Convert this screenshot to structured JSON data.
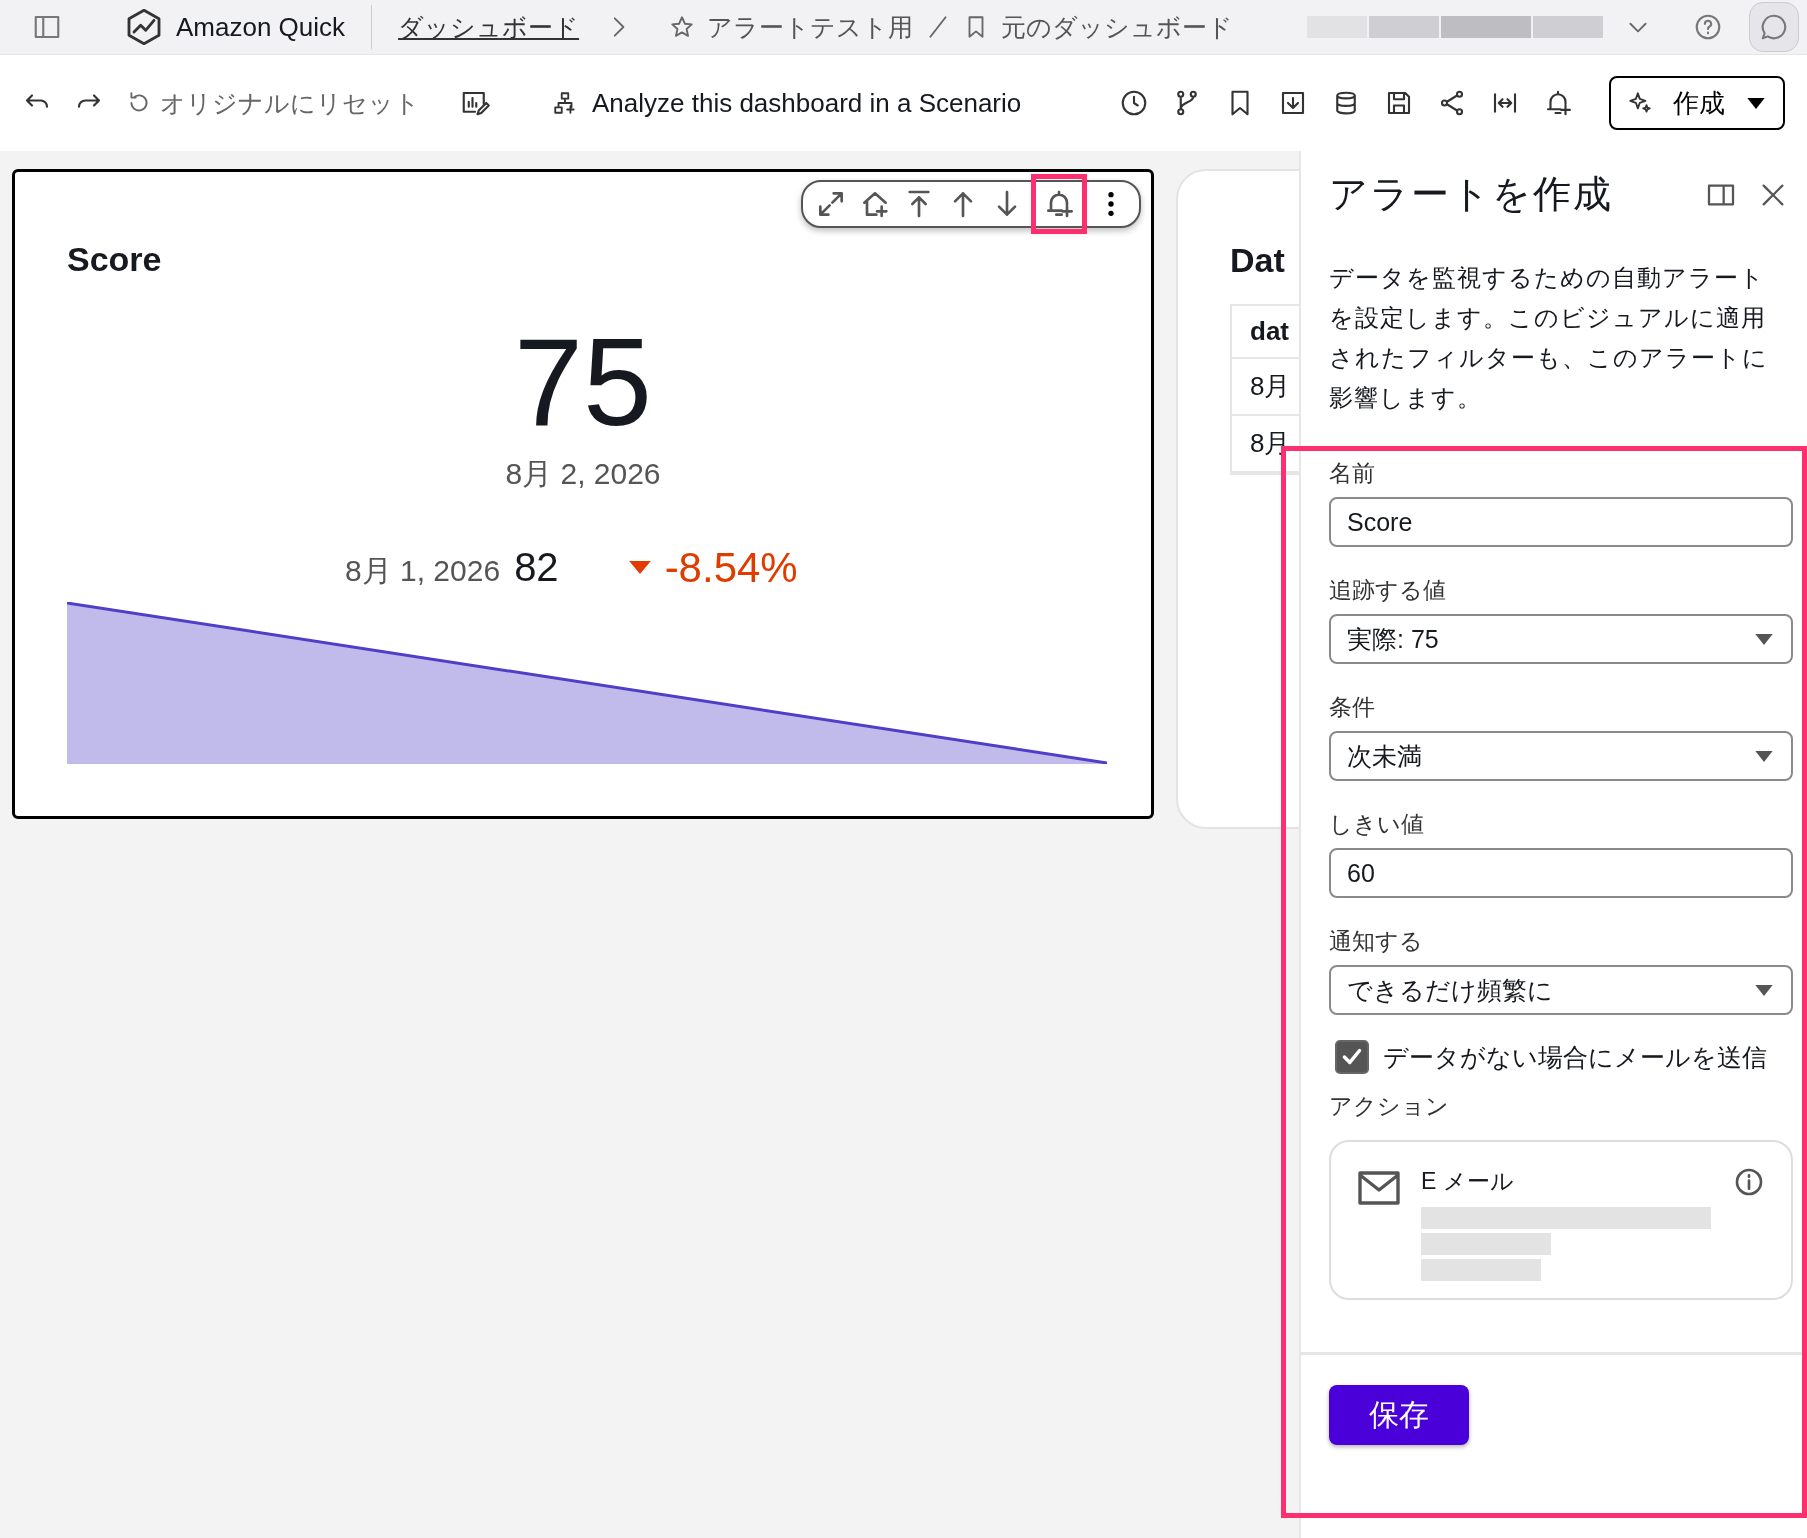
{
  "top_bar": {
    "product": "Amazon Quick",
    "breadcrumbs": [
      {
        "label": "ダッシュボード",
        "kind": "link"
      },
      {
        "label": "アラートテスト用",
        "kind": "star"
      },
      {
        "label": "元のダッシュボード",
        "kind": "bookmark"
      }
    ]
  },
  "toolbar": {
    "reset": {
      "label": "オリジナルにリセット",
      "disabled": true
    },
    "scenario": "Analyze this dashboard in a Scenario",
    "create": "作成"
  },
  "kpi": {
    "title": "Score",
    "value": "75",
    "date": "8月 2, 2026",
    "compare_date": "8月 1, 2026",
    "compare_value": "82",
    "change": "-8.54%"
  },
  "table_visual": {
    "title": "Dat",
    "column": "dat",
    "rows": [
      "8月",
      "8月"
    ]
  },
  "panel": {
    "title": "アラートを作成",
    "description": "データを監視するための自動アラートを設定します。このビジュアルに適用されたフィルターも、このアラートに影響します。",
    "fields": [
      {
        "label": "名前",
        "kind": "text",
        "value": "Score"
      },
      {
        "label": "追跡する値",
        "kind": "select",
        "value": "実際: 75"
      },
      {
        "label": "条件",
        "kind": "select",
        "value": "次未満"
      },
      {
        "label": "しきい値",
        "kind": "text",
        "value": "60"
      },
      {
        "label": "通知する",
        "kind": "select",
        "value": "できるだけ頻繁に"
      }
    ],
    "checkbox": {
      "label": "データがない場合にメールを送信",
      "checked": true
    },
    "actions_label": "アクション",
    "action": {
      "title": "E メール"
    },
    "save": "保存"
  }
}
